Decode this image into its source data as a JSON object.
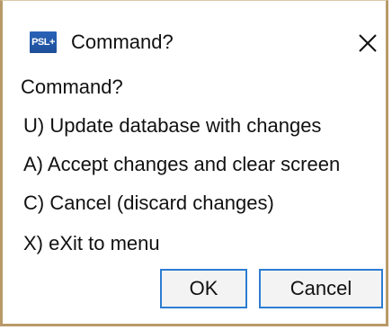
{
  "window": {
    "title": "Command?",
    "app_icon_text": "PSL+",
    "close_icon": "close-icon"
  },
  "dialog": {
    "prompt": "Command?",
    "options": [
      {
        "label": "U) Update database with changes"
      },
      {
        "label": "A) Accept changes and clear screen"
      },
      {
        "label": "C) Cancel (discard changes)"
      },
      {
        "label": "X) eXit to menu"
      }
    ]
  },
  "buttons": {
    "ok_label": "OK",
    "cancel_label": "Cancel"
  },
  "colors": {
    "border": "#b89a68",
    "button_focus": "#2d7dd2",
    "icon_blue": "#2a63b8"
  }
}
